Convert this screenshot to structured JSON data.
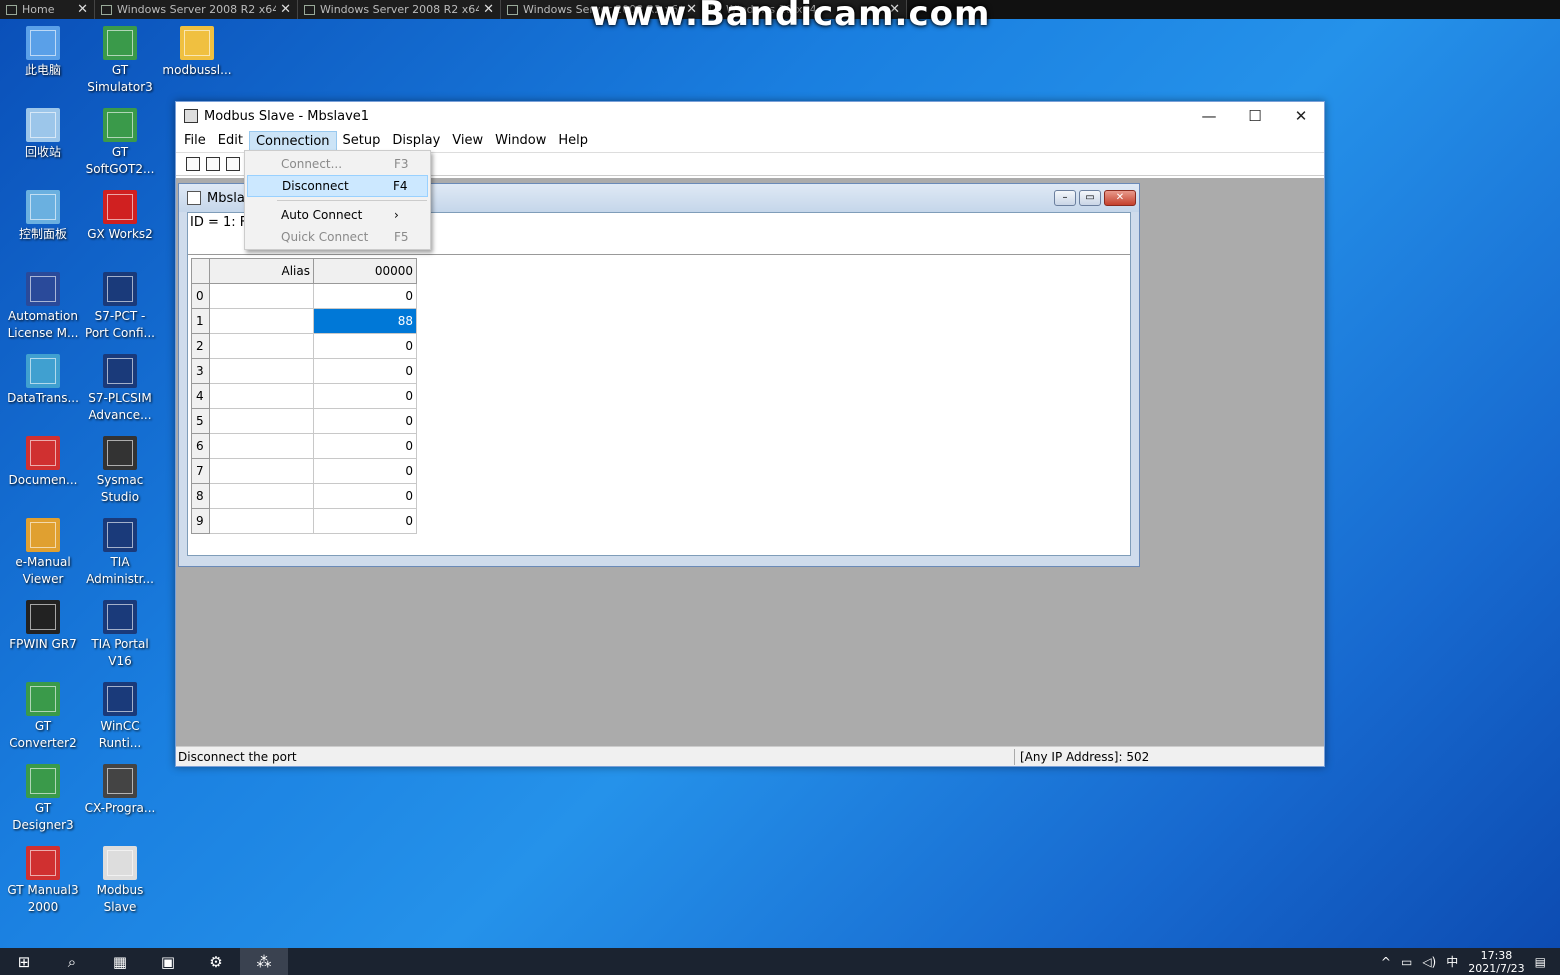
{
  "tabs": [
    {
      "label": "Home"
    },
    {
      "label": "Windows Server 2008 R2 x64"
    },
    {
      "label": "Windows Server 2008 R2 x64"
    },
    {
      "label": "Windows Server 2008 R2 x64"
    },
    {
      "label": "Windows 10 x64"
    }
  ],
  "watermark": "www.Bandicam.com",
  "desktop_icons": [
    {
      "label": "此电脑",
      "icon": "computer-icon",
      "color": "#5aa0e8"
    },
    {
      "label": "GT Simulator3",
      "icon": "gt-simulator-icon",
      "color": "#3a9a4a"
    },
    {
      "label": "modbussl...",
      "icon": "folder-icon",
      "color": "#f0c040"
    },
    {
      "label": "回收站",
      "icon": "recycle-bin-icon",
      "color": "#9cc6ea"
    },
    {
      "label": "GT SoftGOT2...",
      "icon": "softgot-icon",
      "color": "#3a9a4a"
    },
    {
      "label": "控制面板",
      "icon": "control-panel-icon",
      "color": "#6ab0e0"
    },
    {
      "label": "GX Works2",
      "icon": "gx-works-icon",
      "color": "#d02020"
    },
    {
      "label": "Automation License M...",
      "icon": "license-icon",
      "color": "#2a4a9a"
    },
    {
      "label": "S7-PCT - Port Confi...",
      "icon": "s7-pct-icon",
      "color": "#1a3a7a"
    },
    {
      "label": "DataTrans...",
      "icon": "datatrans-icon",
      "color": "#40a0d0"
    },
    {
      "label": "S7-PLCSIM Advance...",
      "icon": "plcsim-icon",
      "color": "#1a3a7a"
    },
    {
      "label": "Documen...",
      "icon": "document-icon",
      "color": "#d03030"
    },
    {
      "label": "Sysmac Studio",
      "icon": "sysmac-icon",
      "color": "#333"
    },
    {
      "label": "e-Manual Viewer",
      "icon": "emanual-icon",
      "color": "#e0a030"
    },
    {
      "label": "TIA Administr...",
      "icon": "tia-admin-icon",
      "color": "#1a3a7a"
    },
    {
      "label": "FPWIN GR7",
      "icon": "fpwin-icon",
      "color": "#222"
    },
    {
      "label": "TIA Portal V16",
      "icon": "tia-portal-icon",
      "color": "#1a3a7a"
    },
    {
      "label": "GT Converter2",
      "icon": "gt-converter-icon",
      "color": "#3a9a4a"
    },
    {
      "label": "WinCC Runti...",
      "icon": "wincc-icon",
      "color": "#1a3a7a"
    },
    {
      "label": "GT Designer3",
      "icon": "gt-designer-icon",
      "color": "#3a9a4a"
    },
    {
      "label": "CX-Progra...",
      "icon": "cx-programmer-icon",
      "color": "#444"
    },
    {
      "label": "GT Manual3 2000",
      "icon": "gt-manual-icon",
      "color": "#d03030"
    },
    {
      "label": "Modbus Slave",
      "icon": "modbus-slave-icon",
      "color": "#ddd"
    }
  ],
  "window": {
    "title": "Modbus Slave - Mbslave1",
    "minimize": "—",
    "maximize": "☐",
    "close": "✕"
  },
  "menu": [
    "File",
    "Edit",
    "Connection",
    "Setup",
    "Display",
    "View",
    "Window",
    "Help"
  ],
  "dropdown": [
    {
      "label": "Connect...",
      "shortcut": "F3",
      "state": "disabled"
    },
    {
      "label": "Disconnect",
      "shortcut": "F4",
      "state": "highlighted"
    },
    {
      "label": "",
      "shortcut": "",
      "state": "separator"
    },
    {
      "label": "Auto Connect",
      "shortcut": "›",
      "state": "normal"
    },
    {
      "label": "Quick Connect",
      "shortcut": "F5",
      "state": "disabled"
    }
  ],
  "child": {
    "title": "Mbsla",
    "id_line": "ID = 1: F",
    "columns": {
      "alias": "Alias",
      "value": "00000"
    },
    "rows": [
      {
        "n": "0",
        "v": "0"
      },
      {
        "n": "1",
        "v": "88"
      },
      {
        "n": "2",
        "v": "0"
      },
      {
        "n": "3",
        "v": "0"
      },
      {
        "n": "4",
        "v": "0"
      },
      {
        "n": "5",
        "v": "0"
      },
      {
        "n": "6",
        "v": "0"
      },
      {
        "n": "7",
        "v": "0"
      },
      {
        "n": "8",
        "v": "0"
      },
      {
        "n": "9",
        "v": "0"
      }
    ],
    "selected_row": 1
  },
  "status": {
    "left": "Disconnect the port",
    "right": "[Any IP Address]: 502"
  },
  "taskbar": {
    "clock_time": "17:38",
    "clock_date": "2021/7/23",
    "ime": "中"
  }
}
